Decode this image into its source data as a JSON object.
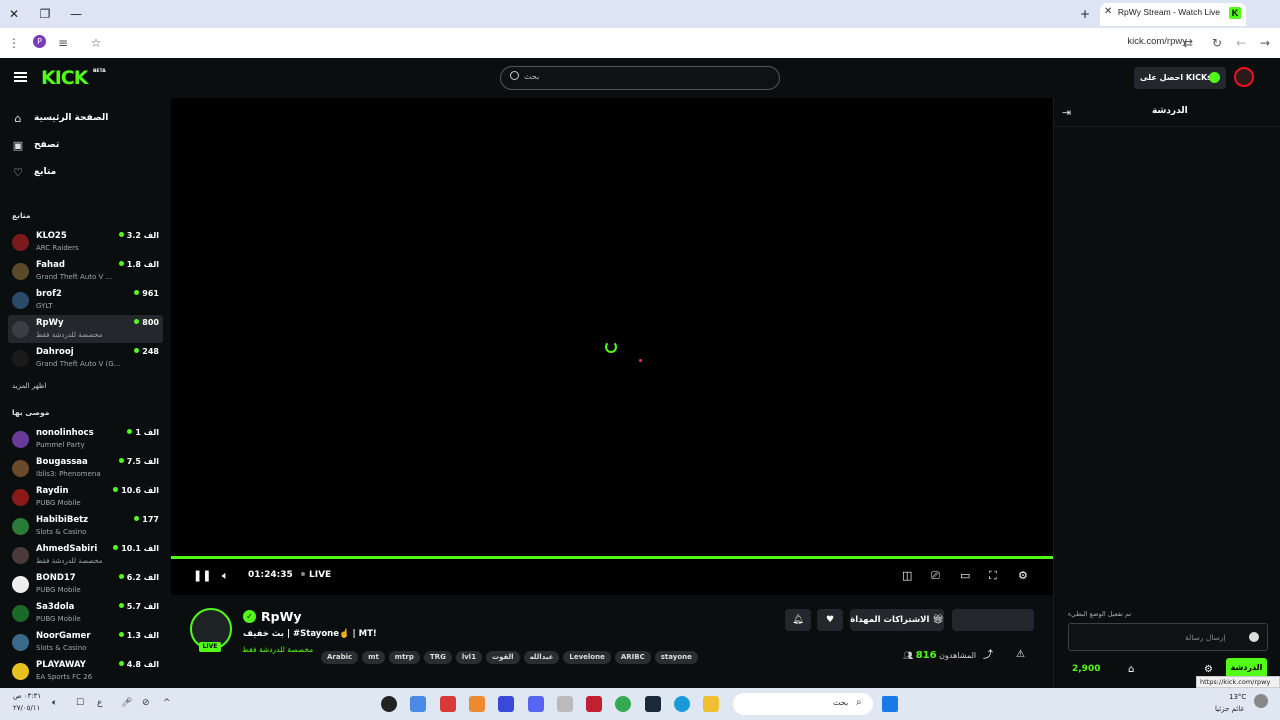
{
  "browser": {
    "tab_title": "RpWy Stream - Watch Live",
    "tab_favicon": "K",
    "url": "kick.com/rpwy",
    "profile_initial": "P",
    "status_url": "https://kick.com/rpwy"
  },
  "header": {
    "logo": "KICK",
    "logo_badge": "BETA",
    "search_placeholder": "بحث",
    "kicks_button": "احصل على KICKs"
  },
  "sidebar": {
    "nav": [
      {
        "label": "الصفحة الرئيسية",
        "icon": "home-icon"
      },
      {
        "label": "تصفح",
        "icon": "browse-icon"
      },
      {
        "label": "متابع",
        "icon": "heart-icon"
      }
    ],
    "following_title": "متابع",
    "following": [
      {
        "name": "KLO25",
        "category": "ARC Raiders",
        "viewers": "3.2 الف",
        "avatar_color": "#7a1a1a"
      },
      {
        "name": "Fahad",
        "category": "Grand Theft Auto V ...",
        "viewers": "1.8 الف",
        "avatar_color": "#5a4a2a"
      },
      {
        "name": "brof2",
        "category": "GYLT",
        "viewers": "961",
        "avatar_color": "#2a4a6a"
      },
      {
        "name": "RpWy",
        "category": "مخصصة للدردشة فقط",
        "viewers": "800",
        "avatar_color": "#3a3f44",
        "active": true
      },
      {
        "name": "Dahrooj",
        "category": "Grand Theft Auto V (G...",
        "viewers": "248",
        "avatar_color": "#1a1a1a"
      }
    ],
    "show_more": "اظهر المزيد",
    "recommended_title": "موصى بها",
    "recommended": [
      {
        "name": "nonolinhocs",
        "category": "Pummel Party",
        "viewers": "1 الف",
        "avatar_color": "#6a3a9a"
      },
      {
        "name": "Bougassaa",
        "category": "Iblis3: Phenomena",
        "viewers": "7.5 الف",
        "avatar_color": "#6a4a2a"
      },
      {
        "name": "Raydin",
        "category": "PUBG Mobile",
        "viewers": "10.6 الف",
        "avatar_color": "#8a1a1a"
      },
      {
        "name": "HabibiBetz",
        "category": "Slots & Casino",
        "viewers": "177",
        "avatar_color": "#2a7a3a"
      },
      {
        "name": "AhmedSabiri",
        "category": "مخصصة للدردشة فقط",
        "viewers": "10.1 الف",
        "avatar_color": "#4a3a3a"
      },
      {
        "name": "BOND17",
        "category": "PUBG Mobile",
        "viewers": "6.2 الف",
        "avatar_color": "#eeeeee"
      },
      {
        "name": "Sa3dola",
        "category": "PUBG Mobile",
        "viewers": "5.7 الف",
        "avatar_color": "#1a6a2a"
      },
      {
        "name": "NoorGamer",
        "category": "Slots & Casino",
        "viewers": "1.3 الف",
        "avatar_color": "#3a6a8a"
      },
      {
        "name": "PLAYAWAY",
        "category": "EA Sports FC 26",
        "viewers": "4.8 الف",
        "avatar_color": "#e8c020"
      }
    ]
  },
  "player": {
    "time": "01:24:35",
    "live_label": "LIVE"
  },
  "stream": {
    "streamer": "RpWy",
    "live_badge": "LIVE",
    "title": "بث خفيف | #Stayone☝️ | MT!",
    "category": "مخصصة للدردشة فقط",
    "tags": [
      "Arabic",
      "mt",
      "mtrp",
      "TRG",
      "lvl1",
      "القوت",
      "عبدالله",
      "Levelone",
      "ARIBC",
      "stayone"
    ],
    "subscribe_button": "الاشتراكات المهداة",
    "viewers_label": "المشاهدون",
    "viewer_count": "816"
  },
  "chat": {
    "title": "الدردشة",
    "slow_mode_notice": "تم تفعيل الوضع البطيء",
    "input_placeholder": "إرسال رسالة",
    "points": "2,900",
    "send_button": "الدردشة"
  },
  "taskbar": {
    "search_label": "بحث",
    "clock_time": "٠٣:٣١ ص",
    "clock_date": "٢٧/٠٥/١١",
    "weather_temp": "13°C",
    "weather_desc": "غائم جزئيا",
    "lang": "ع"
  }
}
